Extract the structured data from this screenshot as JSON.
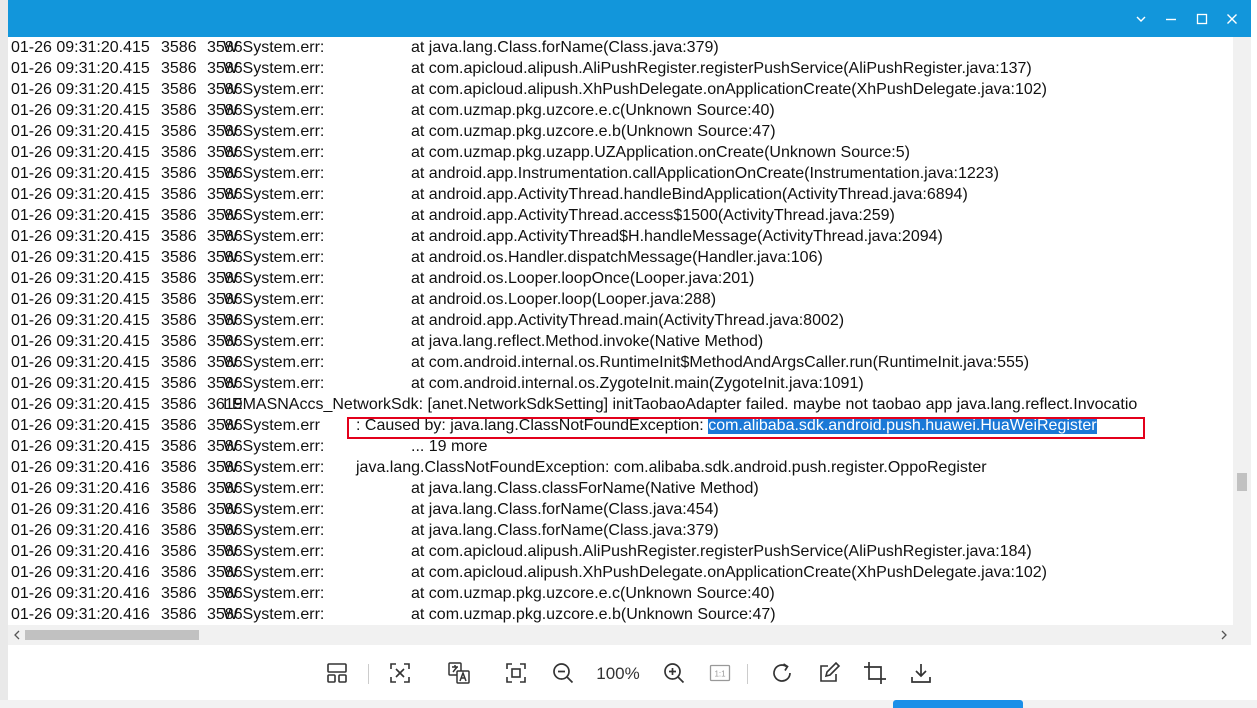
{
  "window": {
    "buttons": [
      "collapse",
      "minimize",
      "maximize",
      "close"
    ]
  },
  "log_lines": [
    {
      "date": "01-26 09:31:20.415",
      "pid": "3586",
      "tid": "3586",
      "tag": "W System.err:",
      "message": "at java.lang.Class.forName(Class.java:379)"
    },
    {
      "date": "01-26 09:31:20.415",
      "pid": "3586",
      "tid": "3586",
      "tag": "W System.err:",
      "message": "at com.apicloud.alipush.AliPushRegister.registerPushService(AliPushRegister.java:137)"
    },
    {
      "date": "01-26 09:31:20.415",
      "pid": "3586",
      "tid": "3586",
      "tag": "W System.err:",
      "message": "at com.apicloud.alipush.XhPushDelegate.onApplicationCreate(XhPushDelegate.java:102)"
    },
    {
      "date": "01-26 09:31:20.415",
      "pid": "3586",
      "tid": "3586",
      "tag": "W System.err:",
      "message": "at com.uzmap.pkg.uzcore.e.c(Unknown Source:40)"
    },
    {
      "date": "01-26 09:31:20.415",
      "pid": "3586",
      "tid": "3586",
      "tag": "W System.err:",
      "message": "at com.uzmap.pkg.uzcore.e.b(Unknown Source:47)"
    },
    {
      "date": "01-26 09:31:20.415",
      "pid": "3586",
      "tid": "3586",
      "tag": "W System.err:",
      "message": "at com.uzmap.pkg.uzapp.UZApplication.onCreate(Unknown Source:5)"
    },
    {
      "date": "01-26 09:31:20.415",
      "pid": "3586",
      "tid": "3586",
      "tag": "W System.err:",
      "message": "at android.app.Instrumentation.callApplicationOnCreate(Instrumentation.java:1223)"
    },
    {
      "date": "01-26 09:31:20.415",
      "pid": "3586",
      "tid": "3586",
      "tag": "W System.err:",
      "message": "at android.app.ActivityThread.handleBindApplication(ActivityThread.java:6894)"
    },
    {
      "date": "01-26 09:31:20.415",
      "pid": "3586",
      "tid": "3586",
      "tag": "W System.err:",
      "message": "at android.app.ActivityThread.access$1500(ActivityThread.java:259)"
    },
    {
      "date": "01-26 09:31:20.415",
      "pid": "3586",
      "tid": "3586",
      "tag": "W System.err:",
      "message": "at android.app.ActivityThread$H.handleMessage(ActivityThread.java:2094)"
    },
    {
      "date": "01-26 09:31:20.415",
      "pid": "3586",
      "tid": "3586",
      "tag": "W System.err:",
      "message": "at android.os.Handler.dispatchMessage(Handler.java:106)"
    },
    {
      "date": "01-26 09:31:20.415",
      "pid": "3586",
      "tid": "3586",
      "tag": "W System.err:",
      "message": "at android.os.Looper.loopOnce(Looper.java:201)"
    },
    {
      "date": "01-26 09:31:20.415",
      "pid": "3586",
      "tid": "3586",
      "tag": "W System.err:",
      "message": "at android.os.Looper.loop(Looper.java:288)"
    },
    {
      "date": "01-26 09:31:20.415",
      "pid": "3586",
      "tid": "3586",
      "tag": "W System.err:",
      "message": "at android.app.ActivityThread.main(ActivityThread.java:8002)"
    },
    {
      "date": "01-26 09:31:20.415",
      "pid": "3586",
      "tid": "3586",
      "tag": "W System.err:",
      "message": "at java.lang.reflect.Method.invoke(Native Method)"
    },
    {
      "date": "01-26 09:31:20.415",
      "pid": "3586",
      "tid": "3586",
      "tag": "W System.err:",
      "message": "at com.android.internal.os.RuntimeInit$MethodAndArgsCaller.run(RuntimeInit.java:555)"
    },
    {
      "date": "01-26 09:31:20.415",
      "pid": "3586",
      "tid": "3586",
      "tag": "W System.err:",
      "message": "at com.android.internal.os.ZygoteInit.main(ZygoteInit.java:1091)"
    },
    {
      "date": "01-26 09:31:20.415",
      "pid": "3586",
      "tid": "3619",
      "tag": "I EMASNAccs_NetworkSdk: [anet.NetworkSdkSetting] initTaobaoAdapter failed. maybe not taobao app java.lang.reflect.Invocatio",
      "message": ""
    },
    {
      "date": "01-26 09:31:20.415",
      "pid": "3586",
      "tid": "3586",
      "tag": "W System.err",
      "message": ": Caused by: java.lang.ClassNotFoundException: ",
      "highlight": "com.alibaba.sdk.android.push.huawei.HuaWeiRegister"
    },
    {
      "date": "01-26 09:31:20.415",
      "pid": "3586",
      "tid": "3586",
      "tag": "W System.err:",
      "message": "... 19 more"
    },
    {
      "date": "01-26 09:31:20.416",
      "pid": "3586",
      "tid": "3586",
      "tag": "W System.err:",
      "message": "java.lang.ClassNotFoundException: com.alibaba.sdk.android.push.register.OppoRegister",
      "wide": true
    },
    {
      "date": "01-26 09:31:20.416",
      "pid": "3586",
      "tid": "3586",
      "tag": "W System.err:",
      "message": "at java.lang.Class.classForName(Native Method)"
    },
    {
      "date": "01-26 09:31:20.416",
      "pid": "3586",
      "tid": "3586",
      "tag": "W System.err:",
      "message": "at java.lang.Class.forName(Class.java:454)"
    },
    {
      "date": "01-26 09:31:20.416",
      "pid": "3586",
      "tid": "3586",
      "tag": "W System.err:",
      "message": "at java.lang.Class.forName(Class.java:379)"
    },
    {
      "date": "01-26 09:31:20.416",
      "pid": "3586",
      "tid": "3586",
      "tag": "W System.err:",
      "message": "at com.apicloud.alipush.AliPushRegister.registerPushService(AliPushRegister.java:184)"
    },
    {
      "date": "01-26 09:31:20.416",
      "pid": "3586",
      "tid": "3586",
      "tag": "W System.err:",
      "message": "at com.apicloud.alipush.XhPushDelegate.onApplicationCreate(XhPushDelegate.java:102)"
    },
    {
      "date": "01-26 09:31:20.416",
      "pid": "3586",
      "tid": "3586",
      "tag": "W System.err:",
      "message": "at com.uzmap.pkg.uzcore.e.c(Unknown Source:40)"
    },
    {
      "date": "01-26 09:31:20.416",
      "pid": "3586",
      "tid": "3586",
      "tag": "W System.err:",
      "message": "at com.uzmap.pkg.uzcore.e.b(Unknown Source:47)"
    }
  ],
  "toolbar": {
    "zoom_label": "100%",
    "actual_size_label": "1:1",
    "icons": [
      "thumbnail-layout-icon",
      "ocr-extract-icon",
      "translate-icon",
      "fit-screen-icon",
      "zoom-out-icon",
      "zoom-in-icon",
      "actual-size-icon",
      "rotate-icon",
      "edit-icon",
      "crop-icon",
      "download-icon"
    ]
  },
  "colors": {
    "titlebar": "#1296db",
    "selection": "#1b78d6",
    "annotation_box": "#e3001b",
    "text": "#111111"
  }
}
